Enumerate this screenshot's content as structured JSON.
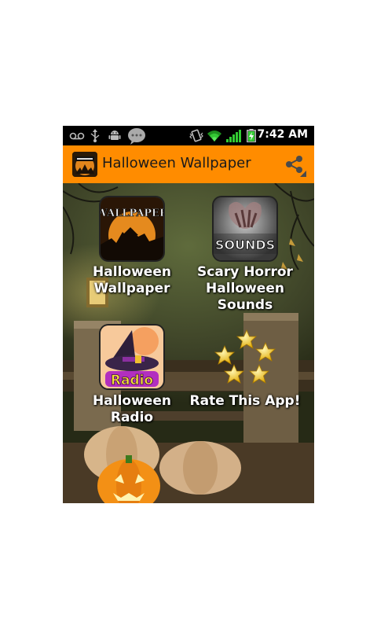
{
  "status_bar": {
    "time": "7:42 AM",
    "icons": [
      "voicemail-icon",
      "usb-icon",
      "android-debug-icon",
      "chat-icon",
      "vibrate-icon",
      "wifi-icon",
      "signal-icon",
      "battery-charging-icon"
    ]
  },
  "action_bar": {
    "title": "Halloween Wallpaper",
    "share_icon": "share-icon",
    "accent": "#ff8c00"
  },
  "tiles": [
    {
      "label": "Halloween Wallpaper",
      "icon_text": "WALLPAPER"
    },
    {
      "label": "Scary Horror Halloween Sounds",
      "icon_text": "SOUNDS"
    },
    {
      "label": "Halloween Radio",
      "icon_text": "Radio"
    },
    {
      "label": "Rate This App!",
      "icon": "stars-icon"
    }
  ]
}
